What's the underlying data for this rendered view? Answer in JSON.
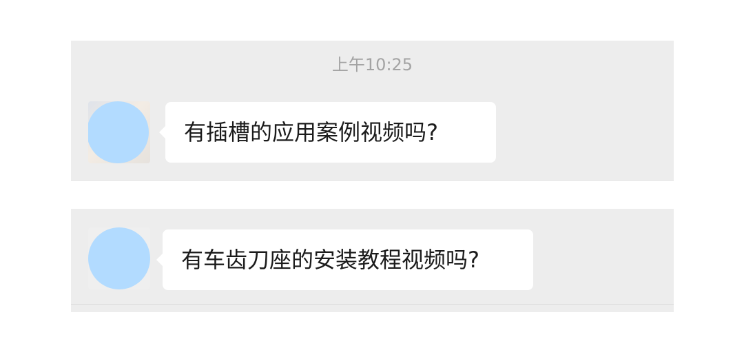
{
  "chat": {
    "timestamp": "上午10:25",
    "messages": [
      {
        "text": "有插槽的应用案例视频吗?",
        "sender": "incoming",
        "avatar": "avatar-photo-blurred"
      },
      {
        "text": "有车齿刀座的安装教程视频吗?",
        "sender": "incoming",
        "avatar": "avatar-blurred"
      }
    ],
    "colors": {
      "panel_background": "#ededed",
      "bubble_background": "#ffffff",
      "avatar_redaction": "#b2dbff",
      "timestamp_text": "#a3a3a3"
    }
  }
}
